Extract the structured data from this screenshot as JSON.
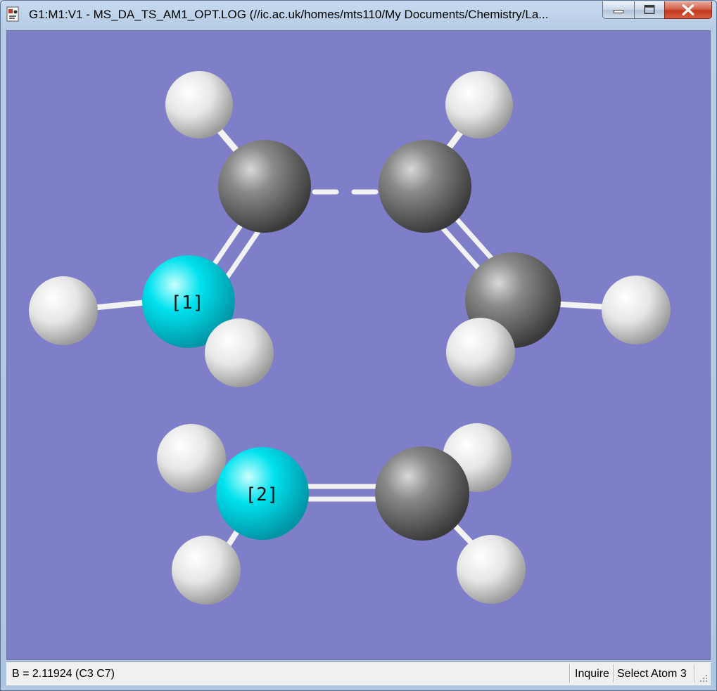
{
  "window": {
    "title": "G1:M1:V1 - MS_DA_TS_AM1_OPT.LOG (//ic.ac.uk/homes/mts110/My Documents/Chemistry/La...",
    "icon": "gaussview-document-icon",
    "controls": [
      "minimize-icon",
      "maximize-icon",
      "close-icon"
    ]
  },
  "viewport": {
    "background_color": "#7f7fc9",
    "atom_colors": {
      "carbon": "#7a7a7a",
      "hydrogen": "#f2f2f2",
      "selected": "#00e5f0"
    },
    "atom_labels": {
      "atom1": "[1]",
      "atom2": "[2]"
    }
  },
  "status": {
    "measurement": "B = 2.11924 (C3 C7)",
    "mode": "Inquire",
    "action": "Select Atom 3"
  }
}
